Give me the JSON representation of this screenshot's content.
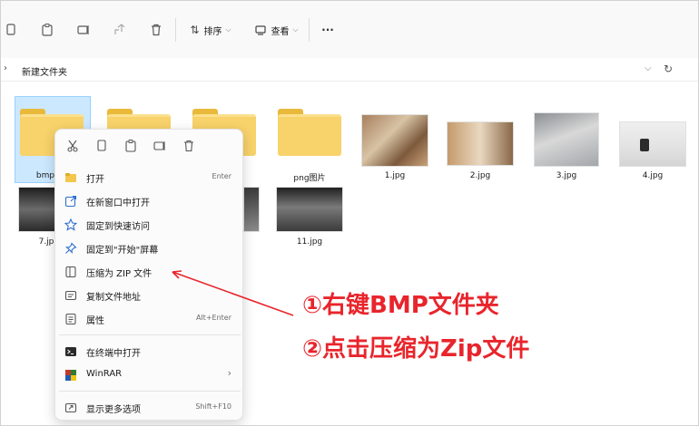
{
  "toolbar": {
    "sort_label": "排序",
    "view_label": "查看",
    "more_label": "···"
  },
  "address": {
    "path": "新建文件夹"
  },
  "items": {
    "bmp_label": "bmp",
    "png_label": "png图片",
    "img1": "1.jpg",
    "img2": "2.jpg",
    "img3": "3.jpg",
    "img4": "4.jpg",
    "img7": "7.jp",
    "img11": "11.jpg"
  },
  "menu": {
    "items": [
      {
        "label": "打开",
        "shortcut": "Enter"
      },
      {
        "label": "在新窗口中打开",
        "shortcut": ""
      },
      {
        "label": "固定到快速访问",
        "shortcut": ""
      },
      {
        "label": "固定到\"开始\"屏幕",
        "shortcut": ""
      },
      {
        "label": "压缩为 ZIP 文件",
        "shortcut": ""
      },
      {
        "label": "复制文件地址",
        "shortcut": ""
      },
      {
        "label": "属性",
        "shortcut": "Alt+Enter"
      },
      {
        "label": "在终端中打开",
        "shortcut": ""
      },
      {
        "label": "WinRAR",
        "shortcut": "›"
      },
      {
        "label": "显示更多选项",
        "shortcut": "Shift+F10"
      }
    ]
  },
  "annotation": {
    "line1": "①右键BMP文件夹",
    "line2": "②点击压缩为Zip文件"
  },
  "colors": {
    "annotation": "#e8252c",
    "selection": "#cce8ff",
    "folder": "#f8d26a"
  }
}
